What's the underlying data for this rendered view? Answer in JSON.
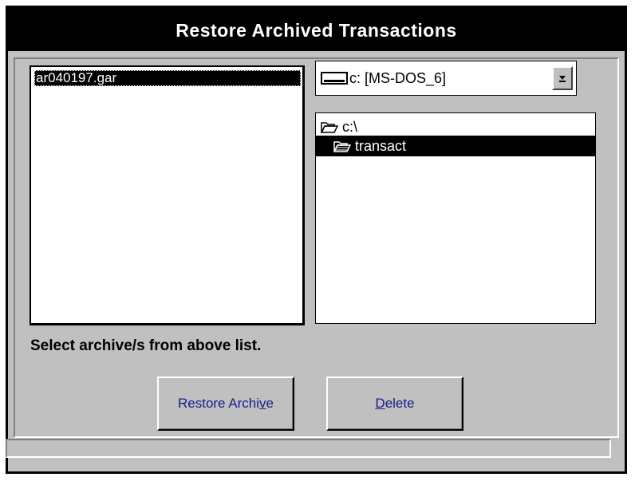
{
  "window": {
    "title": "Restore Archived Transactions"
  },
  "file_list": {
    "items": [
      "ar040197.gar"
    ]
  },
  "drive": {
    "selected": "c: [MS-DOS_6]",
    "icon": "drive-icon"
  },
  "directories": [
    {
      "label": "c:\\",
      "icon": "open-folder-icon"
    },
    {
      "label": "transact",
      "icon": "open-folder-icon"
    }
  ],
  "status_text": "Select archive/s from above list.",
  "buttons": {
    "restore_label": "Restore Archive",
    "delete_label": "Delete"
  },
  "colors": {
    "face": "#c0c0c0",
    "title_bg": "#000000",
    "button_text": "#1a1a8c",
    "selection": "#000000"
  }
}
